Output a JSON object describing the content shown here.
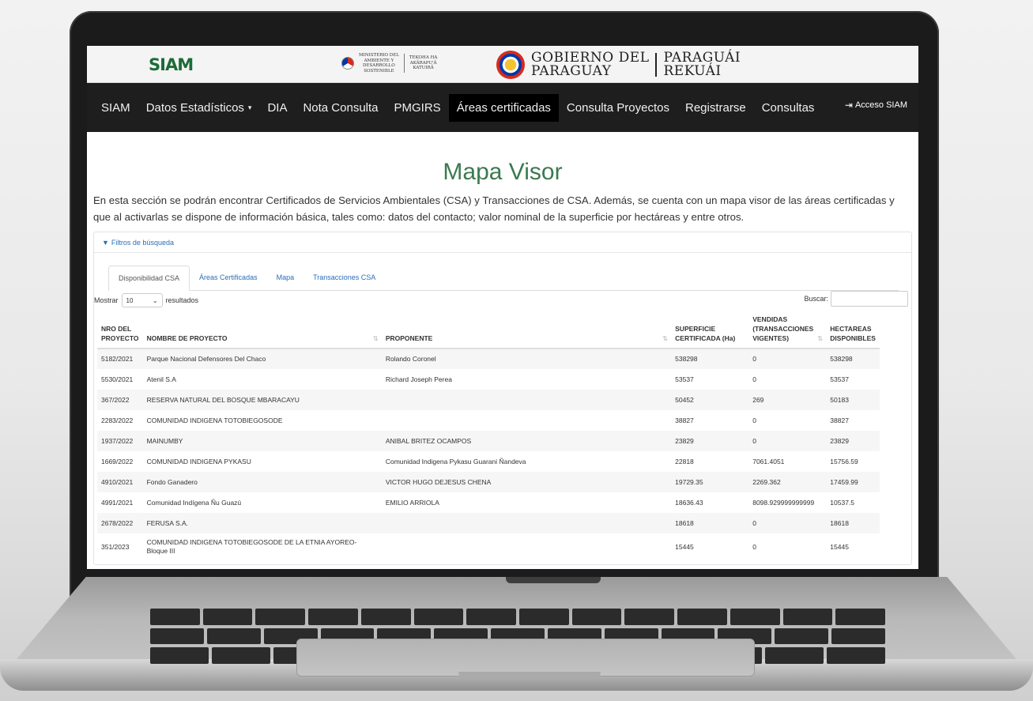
{
  "header": {
    "siam_logo": "SIAM",
    "mades_logo_lines": [
      "MINISTERIO DEL",
      "AMBIENTE Y",
      "DESARROLLO",
      "SOSTENIBLE"
    ],
    "mades_logo_lines_guarani": [
      "TEKOHA HA",
      "AKÃRAPU'Ã",
      "KATUIRÃ"
    ],
    "gov_left": [
      "GOBIERNO DEL",
      "PARAGUAY"
    ],
    "gov_right": [
      "PARAGUÁI",
      "REKUÁI"
    ]
  },
  "navbar": {
    "items": [
      {
        "label": "SIAM"
      },
      {
        "label": "Datos Estadísticos",
        "dropdown": true
      },
      {
        "label": "DIA"
      },
      {
        "label": "Nota Consulta"
      },
      {
        "label": "PMGIRS"
      },
      {
        "label": "Áreas certificadas",
        "active": true
      },
      {
        "label": "Consulta Proyectos"
      },
      {
        "label": "Registrarse"
      },
      {
        "label": "Consultas"
      }
    ],
    "login_label": "Acceso SIAM"
  },
  "page": {
    "title": "Mapa Visor",
    "intro": "En esta sección se podrán encontrar Certificados de Servicios Ambientales (CSA) y Transacciones de CSA. Además, se cuenta con un mapa visor de las áreas certificadas y que al activarlas se dispone de información básica, tales como: datos del contacto; valor nominal de la superficie por hectáreas y entre otros."
  },
  "filters": {
    "title": "Filtros de búsqueda"
  },
  "tabs": [
    "Disponibilidad CSA",
    "Áreas Certificadas",
    "Mapa",
    "Transacciones CSA"
  ],
  "table_controls": {
    "show_label": "Mostrar",
    "length_value": "10",
    "results_label": "resultados",
    "search_label": "Buscar:"
  },
  "table": {
    "headers": [
      "NRO DEL PROYECTO",
      "NOMBRE DE PROYECTO",
      "PROPONENTE",
      "SUPERFICIE CERTIFICADA (Ha)",
      "VENDIDAS (TRANSACCIONES VIGENTES)",
      "HECTAREAS DISPONIBLES"
    ],
    "rows": [
      [
        "5182/2021",
        "Parque Nacional Defensores Del Chaco",
        "Rolando Coronel",
        "538298",
        "0",
        "538298"
      ],
      [
        "5530/2021",
        "Atenil S.A",
        "Richard Joseph Perea",
        "53537",
        "0",
        "53537"
      ],
      [
        "367/2022",
        "RESERVA NATURAL DEL BOSQUE MBARACAYU",
        "",
        "50452",
        "269",
        "50183"
      ],
      [
        "2283/2022",
        "COMUNIDAD INDIGENA TOTOBIEGOSODE",
        "",
        "38827",
        "0",
        "38827"
      ],
      [
        "1937/2022",
        "MAINUMBY",
        "ANIBAL BRITEZ OCAMPOS",
        "23829",
        "0",
        "23829"
      ],
      [
        "1669/2022",
        "COMUNIDAD INDIGENA PYKASU",
        "Comunidad Indigena Pykasu Guarani Ñandeva",
        "22818",
        "7061.4051",
        "15756.59"
      ],
      [
        "4910/2021",
        "Fondo Ganadero",
        "VICTOR HUGO DEJESUS CHENA",
        "19729.35",
        "2269.362",
        "17459.99"
      ],
      [
        "4991/2021",
        "Comunidad Indígena Ñu Guazú",
        "EMILIO ARRIOLA",
        "18636.43",
        "8098.929999999999",
        "10537.5"
      ],
      [
        "2678/2022",
        "FERUSA S.A.",
        "",
        "18618",
        "0",
        "18618"
      ],
      [
        "351/2023",
        "COMUNIDAD INDIGENA TOTOBIEGOSODE DE LA ETNIA AYOREO- Bloque III",
        "",
        "15445",
        "0",
        "15445"
      ]
    ]
  },
  "colors": {
    "title_green": "#3b7a4f",
    "navbar": "#1e1e1e",
    "link_blue": "#2a6db7"
  }
}
